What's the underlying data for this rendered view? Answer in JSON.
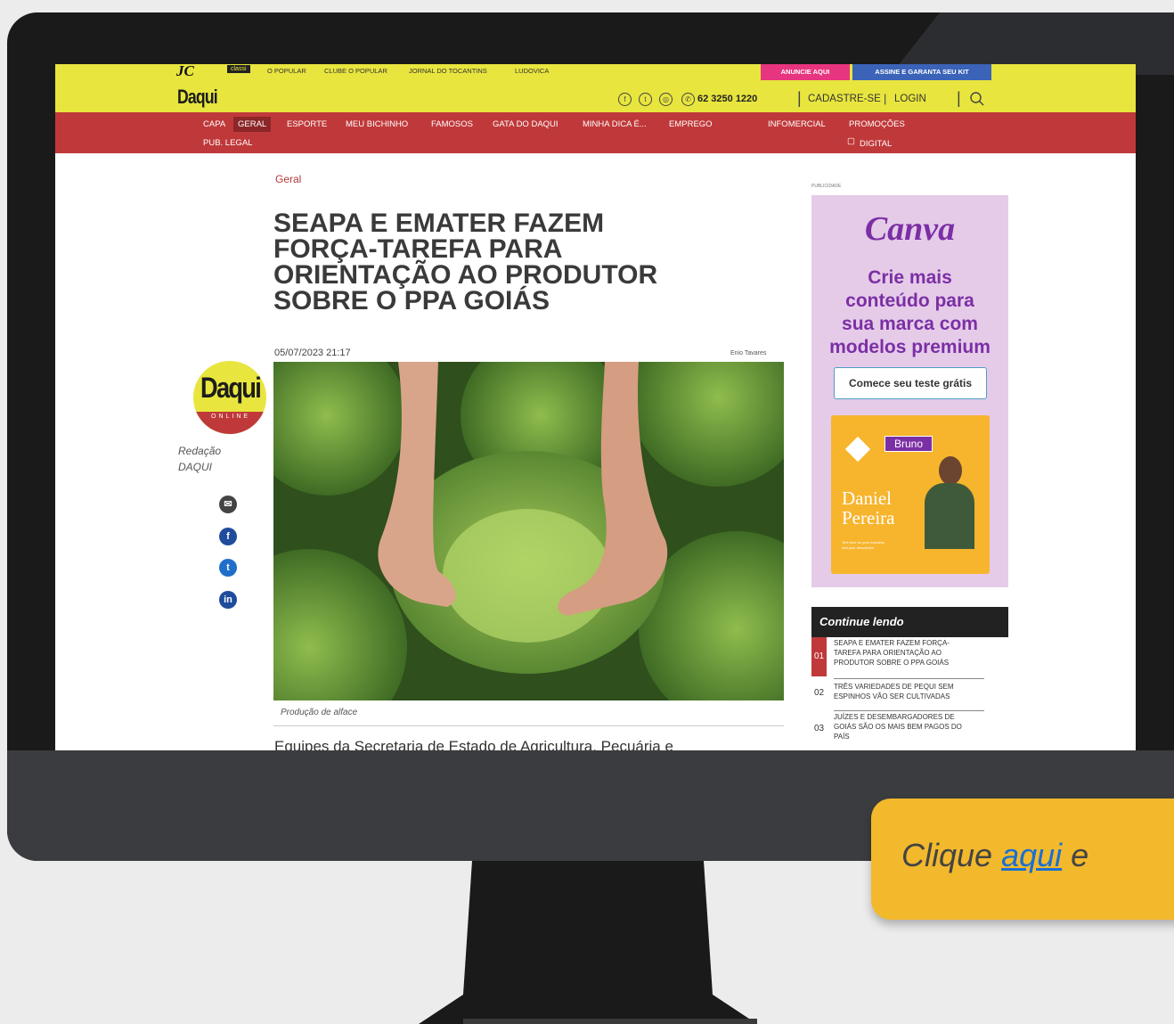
{
  "network": {
    "logo_letters": "JC",
    "classi_badge": "classi",
    "links": [
      "O POPULAR",
      "CLUBE O POPULAR",
      "JORNAL DO TOCANTINS",
      "LUDOVICA"
    ],
    "anuncie": "ANUNCIE AQUI",
    "assine": "ASSINE E GARANTA SEU KIT"
  },
  "header": {
    "logo": "Daqui",
    "phone": "62 3250 1220",
    "cadastre": "CADASTRE-SE",
    "login": "LOGIN",
    "separator": "|"
  },
  "nav": {
    "items": [
      "CAPA",
      "GERAL",
      "ESPORTE",
      "MEU BICHINHO",
      "FAMOSOS",
      "GATA DO DAQUI",
      "MINHA DICA É...",
      "EMPREGO",
      "INFOMERCIAL",
      "PROMOÇÕES"
    ],
    "row2": [
      "PUB. LEGAL"
    ],
    "digital": "DIGITAL",
    "active": "GERAL"
  },
  "article": {
    "category": "Geral",
    "title_lines": [
      "SEAPA E EMATER FAZEM",
      "FORÇA-TAREFA PARA",
      "ORIENTAÇÃO AO PRODUTOR",
      "SOBRE O PPA GOIÁS"
    ],
    "date": "05/07/2023 21:17",
    "photo_credit": "Enio Tavares",
    "caption": "Produção de alface",
    "lead": "Equipes da Secretaria de Estado de Agricultura, Pecuária e"
  },
  "author": {
    "badge": "Daqui",
    "badge_sub": "ONLINE",
    "name_line1": "Redação",
    "name_line2": "DAQUI"
  },
  "sidebar": {
    "pub_label": "PUBLICIDADE",
    "ad": {
      "brand": "Canva",
      "headline": [
        "Crie mais",
        "conteúdo para",
        "sua marca com",
        "modelos premium"
      ],
      "cta": "Comece seu teste grátis",
      "tag": "Bruno",
      "card_name": [
        "Daniel",
        "Pereira"
      ],
      "card_small": [
        "Text here for your business",
        "add your description"
      ]
    },
    "continue_title": "Continue lendo",
    "items": [
      {
        "num": "01",
        "lines": [
          "SEAPA E EMATER FAZEM FORÇA-",
          "TAREFA PARA ORIENTAÇÃO AO",
          "PRODUTOR SOBRE O PPA GOIÁS"
        ]
      },
      {
        "num": "02",
        "lines": [
          "TRÊS VARIEDADES DE PEQUI SEM",
          "ESPINHOS VÃO SER CULTIVADAS"
        ]
      },
      {
        "num": "03",
        "lines": [
          "JUÍZES E DESEMBARGADORES DE",
          "GOIÁS SÃO OS MAIS BEM PAGOS DO",
          "PAÍS"
        ]
      }
    ]
  },
  "callout": {
    "prefix": "Clique ",
    "link": "aqui",
    "suffix": " e"
  },
  "colors": {
    "header_yellow": "#e8e53e",
    "nav_red": "#c0393a",
    "anuncie_pink": "#e8357f",
    "assine_blue": "#3b63b8",
    "title_dark": "#3a3a3a",
    "category_red": "#b33a3a",
    "callout_yellow": "#f3b92c",
    "canva_purple": "#7b2fa5"
  },
  "icons": [
    "facebook-icon",
    "twitter-icon",
    "instagram-icon",
    "whatsapp-icon",
    "search-icon",
    "email-icon",
    "linkedin-icon",
    "tablet-icon"
  ]
}
